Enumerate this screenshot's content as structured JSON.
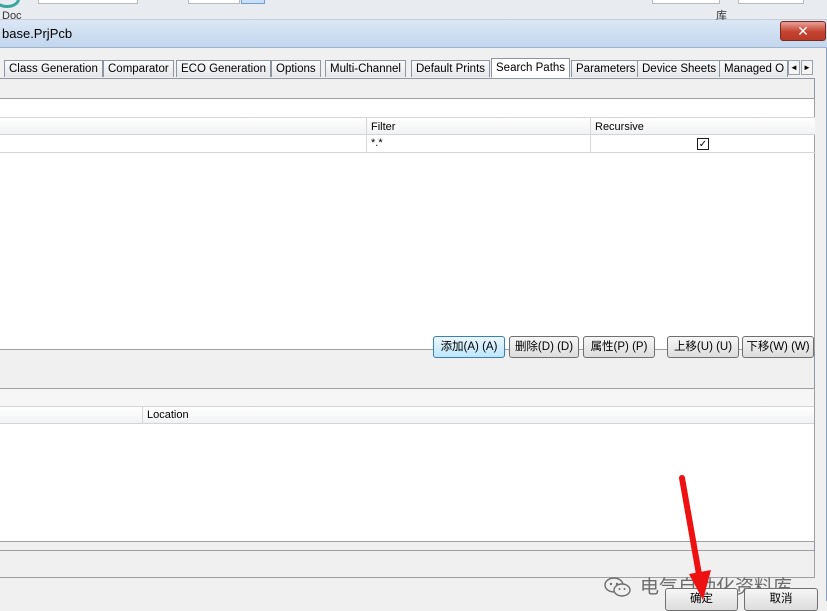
{
  "background": {
    "doc_label": "Doc",
    "lib_label": "库"
  },
  "dialog": {
    "title": "base.PrjPcb",
    "close_label": "✕"
  },
  "tabs": [
    {
      "label": "Class Generation"
    },
    {
      "label": "Comparator"
    },
    {
      "label": "ECO Generation"
    },
    {
      "label": "Options"
    },
    {
      "label": "Multi-Channel"
    },
    {
      "label": "Default Prints"
    },
    {
      "label": "Search Paths",
      "active": true
    },
    {
      "label": "Parameters"
    },
    {
      "label": "Device Sheets"
    },
    {
      "label": "Managed O"
    }
  ],
  "tab_scroll": {
    "left": "◄",
    "right": "►"
  },
  "paths_grid": {
    "columns": [
      "",
      "Filter",
      "Recursive"
    ],
    "rows": [
      {
        "path": "",
        "filter": "*.*",
        "recursive": true
      }
    ]
  },
  "check_mark": "✓",
  "path_buttons": {
    "add": "添加(A) (A)",
    "delete": "删除(D) (D)",
    "properties": "属性(P) (P)",
    "move_up": "上移(U) (U)",
    "move_down": "下移(W) (W)"
  },
  "files_grid": {
    "columns": [
      "",
      "Location"
    ]
  },
  "footer": {
    "ok": "确定",
    "cancel": "取消"
  },
  "watermark": "电气自动化资料库",
  "colors": {
    "annotation_arrow": "#ee1111",
    "close_button": "#c4422f",
    "default_button_border": "#3c7fb1"
  }
}
